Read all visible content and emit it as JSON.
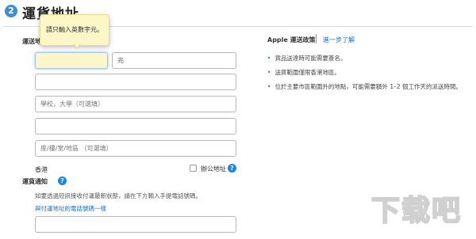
{
  "header": {
    "step_number": "2",
    "title": "運貨地址"
  },
  "section_label": "運送地址",
  "tooltip_text": "請只輸入英數字元。",
  "form": {
    "first_name_value": "",
    "last_name_value": "兆",
    "school_placeholder": "學校，大學（可選填）",
    "unit_placeholder": "座/樓/室/地區 （可選填）"
  },
  "region_label": "香港",
  "business_label": "辦公地址",
  "help_glyph": "?",
  "notification": {
    "label": "運貨通知",
    "description": "如要透過短訊接收付運最新狀態，請在下方輸入手提電話號碼。",
    "link": "與付運地址的電話號碼一樣"
  },
  "policy": {
    "title": "Apple 運送政策",
    "more_link": "進一步了解",
    "bullets": [
      "貨品送達時可能需要簽名。",
      "送貨範圍僅限香港地區。",
      "位於主要市區範圍外的地點，可能需要額外 1–2 個工作天的派送時間。"
    ]
  },
  "watermark_text": "下载吧",
  "colors": {
    "accent": "#1c86e0",
    "focus_bg": "#fdf6c8",
    "link": "#1a6fc4"
  }
}
